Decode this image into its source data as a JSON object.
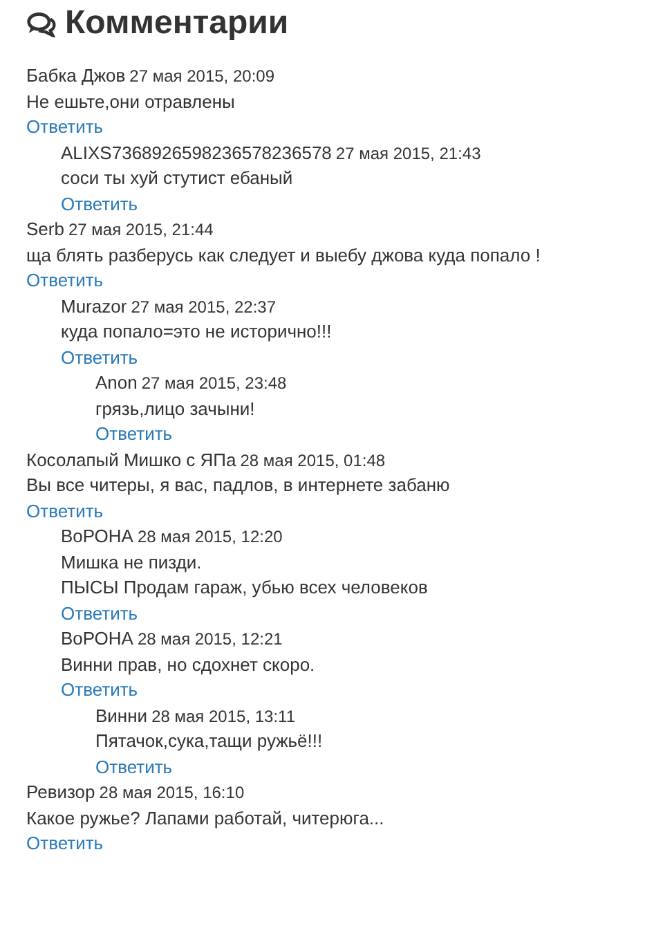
{
  "title": "Комментарии",
  "comments": [
    {
      "author": "Бабка Джов",
      "date": "27 мая 2015, 20:09",
      "lines": [
        "Не ешьте,они отравлены"
      ],
      "reply": "Ответить",
      "children": [
        {
          "author": "ALIXS7368926598236578236578",
          "date": "27 мая 2015, 21:43",
          "lines": [
            "соси ты хуй стутист ебаный"
          ],
          "reply": "Ответить"
        }
      ]
    },
    {
      "author": "Serb",
      "date": "27 мая 2015, 21:44",
      "lines": [
        "ща блять разберусь как следует и выебу джова куда попало !"
      ],
      "reply": "Ответить",
      "children": [
        {
          "author": "Murazor",
          "date": "27 мая 2015, 22:37",
          "lines": [
            "куда попало=это не исторично!!!"
          ],
          "reply": "Ответить",
          "children": [
            {
              "author": "Anon",
              "date": "27 мая 2015, 23:48",
              "lines": [
                "грязь,лицо зачыни!"
              ],
              "reply": "Ответить"
            }
          ]
        }
      ]
    },
    {
      "author": "Косолапый Мишко с ЯПа",
      "date": "28 мая 2015, 01:48",
      "lines": [
        "Вы все читеры, я вас, падлов, в интернете забаню"
      ],
      "reply": "Ответить",
      "children": [
        {
          "author": "ВоРОНА",
          "date": "28 мая 2015, 12:20",
          "lines": [
            "Мишка не пизди.",
            "ПЫСЫ Продам гараж, убью всех человеков"
          ],
          "reply": "Ответить"
        },
        {
          "author": "ВоРОНА",
          "date": "28 мая 2015, 12:21",
          "lines": [
            "Винни прав, но сдохнет скоро."
          ],
          "reply": "Ответить",
          "children": [
            {
              "author": "Винни",
              "date": "28 мая 2015, 13:11",
              "lines": [
                "Пятачок,сука,тащи ружьё!!!"
              ],
              "reply": "Ответить"
            }
          ]
        }
      ]
    },
    {
      "author": "Ревизор",
      "date": "28 мая 2015, 16:10",
      "lines": [
        "Какое ружье? Лапами работай, читерюга..."
      ],
      "reply": "Ответить"
    }
  ]
}
